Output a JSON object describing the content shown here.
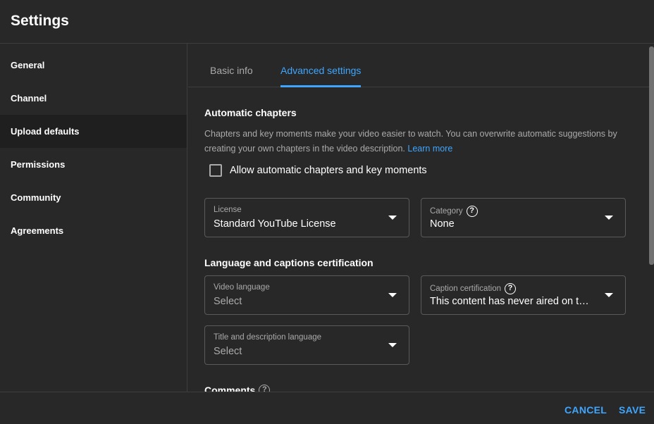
{
  "header": {
    "title": "Settings"
  },
  "sidebar": {
    "items": [
      {
        "label": "General"
      },
      {
        "label": "Channel"
      },
      {
        "label": "Upload defaults",
        "active": true
      },
      {
        "label": "Permissions"
      },
      {
        "label": "Community"
      },
      {
        "label": "Agreements"
      }
    ]
  },
  "tabs": [
    {
      "label": "Basic info"
    },
    {
      "label": "Advanced settings",
      "active": true
    }
  ],
  "auto_chapters": {
    "title": "Automatic chapters",
    "description": "Chapters and key moments make your video easier to watch. You can overwrite automatic suggestions by creating your own chapters in the video description.",
    "learn_more": "Learn more",
    "checkbox_label": "Allow automatic chapters and key moments",
    "checked": false
  },
  "license": {
    "label": "License",
    "value": "Standard YouTube License"
  },
  "category": {
    "label": "Category",
    "value": "None"
  },
  "language_section": {
    "title": "Language and captions certification"
  },
  "video_language": {
    "label": "Video language",
    "value": "Select"
  },
  "caption_certification": {
    "label": "Caption certification",
    "value": "This content has never aired on t…"
  },
  "title_desc_language": {
    "label": "Title and description language",
    "value": "Select"
  },
  "comments": {
    "title": "Comments"
  },
  "footer": {
    "cancel": "CANCEL",
    "save": "SAVE"
  },
  "icons": {
    "help": "?"
  },
  "colors": {
    "accent": "#3ea6ff",
    "background": "#282828",
    "active_sidebar": "#1f1f1f"
  }
}
